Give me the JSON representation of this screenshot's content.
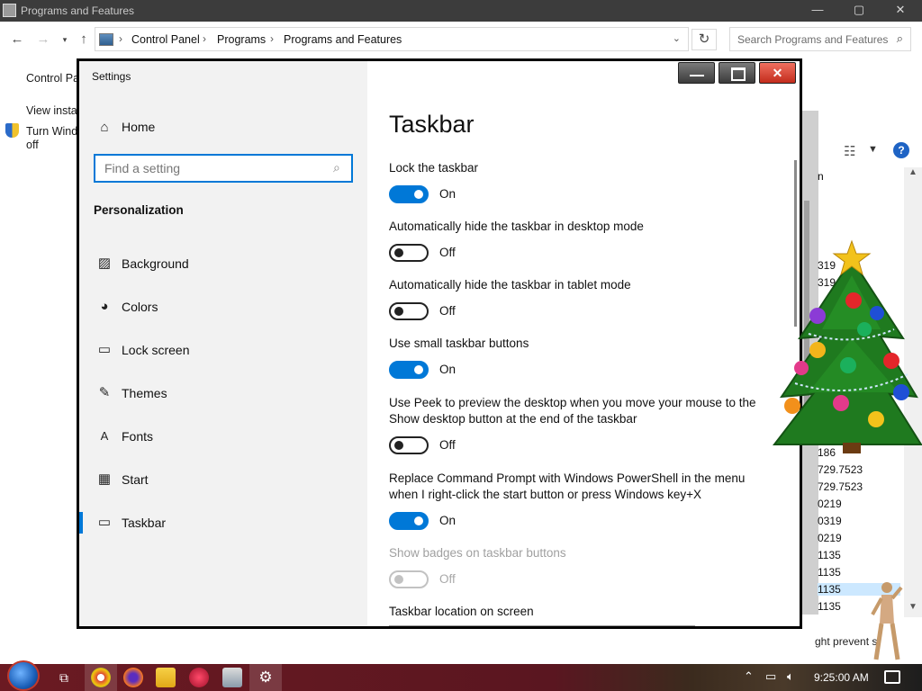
{
  "background_window": {
    "title": "Programs and Features",
    "breadcrumbs": [
      "Control Panel",
      "Programs",
      "Programs and Features"
    ],
    "search_placeholder": "Search Programs and Features",
    "left_links": [
      "Control Pa",
      "View instal",
      "Turn Wind",
      "off"
    ],
    "column_header": "n",
    "version_cells": [
      "319",
      "319",
      "186",
      "186",
      "729.7523",
      "729.7523",
      "0219",
      "0319",
      "0219",
      "1135",
      "1135",
      "1135",
      "1135"
    ],
    "status_text": "ght prevent s"
  },
  "settings": {
    "window_title": "Settings",
    "home_label": "Home",
    "search_placeholder": "Find a setting",
    "section_title": "Personalization",
    "nav_items": [
      {
        "label": "Background",
        "icon": "image-icon"
      },
      {
        "label": "Colors",
        "icon": "palette-icon"
      },
      {
        "label": "Lock screen",
        "icon": "lock-screen-icon"
      },
      {
        "label": "Themes",
        "icon": "brush-icon"
      },
      {
        "label": "Fonts",
        "icon": "font-icon"
      },
      {
        "label": "Start",
        "icon": "start-tiles-icon"
      },
      {
        "label": "Taskbar",
        "icon": "taskbar-icon",
        "active": true
      }
    ],
    "page_title": "Taskbar",
    "settings_list": [
      {
        "label": "Lock the taskbar",
        "state": "On",
        "on": true
      },
      {
        "label": "Automatically hide the taskbar in desktop mode",
        "state": "Off",
        "on": false
      },
      {
        "label": "Automatically hide the taskbar in tablet mode",
        "state": "Off",
        "on": false
      },
      {
        "label": "Use small taskbar buttons",
        "state": "On",
        "on": true
      },
      {
        "label": "Use Peek to preview the desktop when you move your mouse to the Show desktop button at the end of the taskbar",
        "state": "Off",
        "on": false
      },
      {
        "label": "Replace Command Prompt with Windows PowerShell in the menu when I right-click the start button or press Windows key+X",
        "state": "On",
        "on": true
      },
      {
        "label": "Show badges on taskbar buttons",
        "state": "Off",
        "on": false,
        "disabled": true
      }
    ],
    "location_label": "Taskbar location on screen"
  },
  "taskbar": {
    "clock": "9:25:00 AM",
    "accent": "#0078d7"
  }
}
